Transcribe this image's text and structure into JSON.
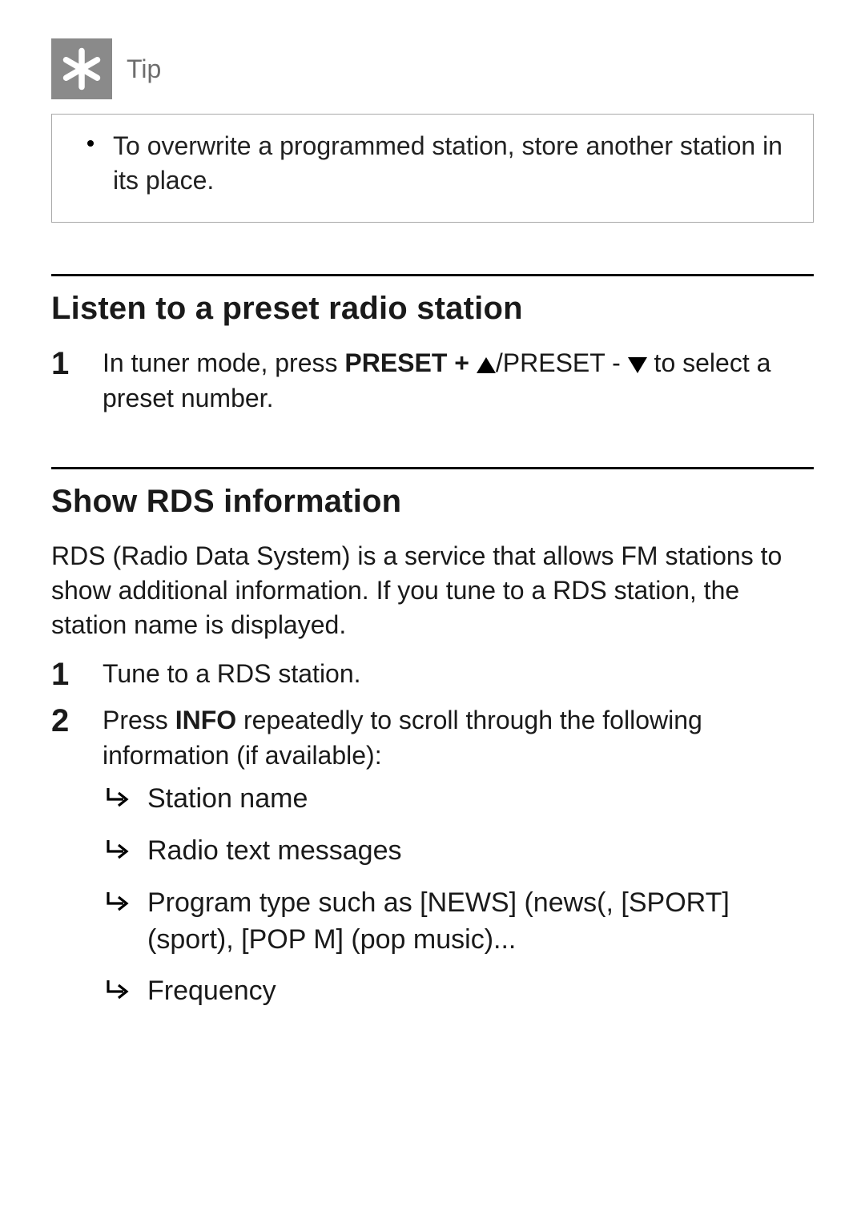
{
  "tip": {
    "label": "Tip",
    "bullets": [
      "To overwrite a programmed station, store another station in its place."
    ]
  },
  "section1": {
    "title": "Listen to a preset radio station",
    "step1": {
      "num": "1",
      "pre": "In tuner mode, press ",
      "bold1": "PRESET + ",
      "mid": "/PRESET - ",
      "tail": " to select a preset number."
    }
  },
  "section2": {
    "title": "Show RDS information",
    "intro": "RDS (Radio Data System) is a service that allows FM stations to show additional information. If you tune to a RDS station, the station name is displayed.",
    "step1": {
      "num": "1",
      "text": "Tune to a RDS station."
    },
    "step2": {
      "num": "2",
      "pre": "Press ",
      "bold": "INFO",
      "post": " repeatedly to scroll through the following information (if available):",
      "arrows": [
        "Station name",
        "Radio text messages",
        "Program type such as [NEWS] (news(, [SPORT] (sport), [POP M] (pop music)...",
        "Frequency"
      ]
    }
  }
}
